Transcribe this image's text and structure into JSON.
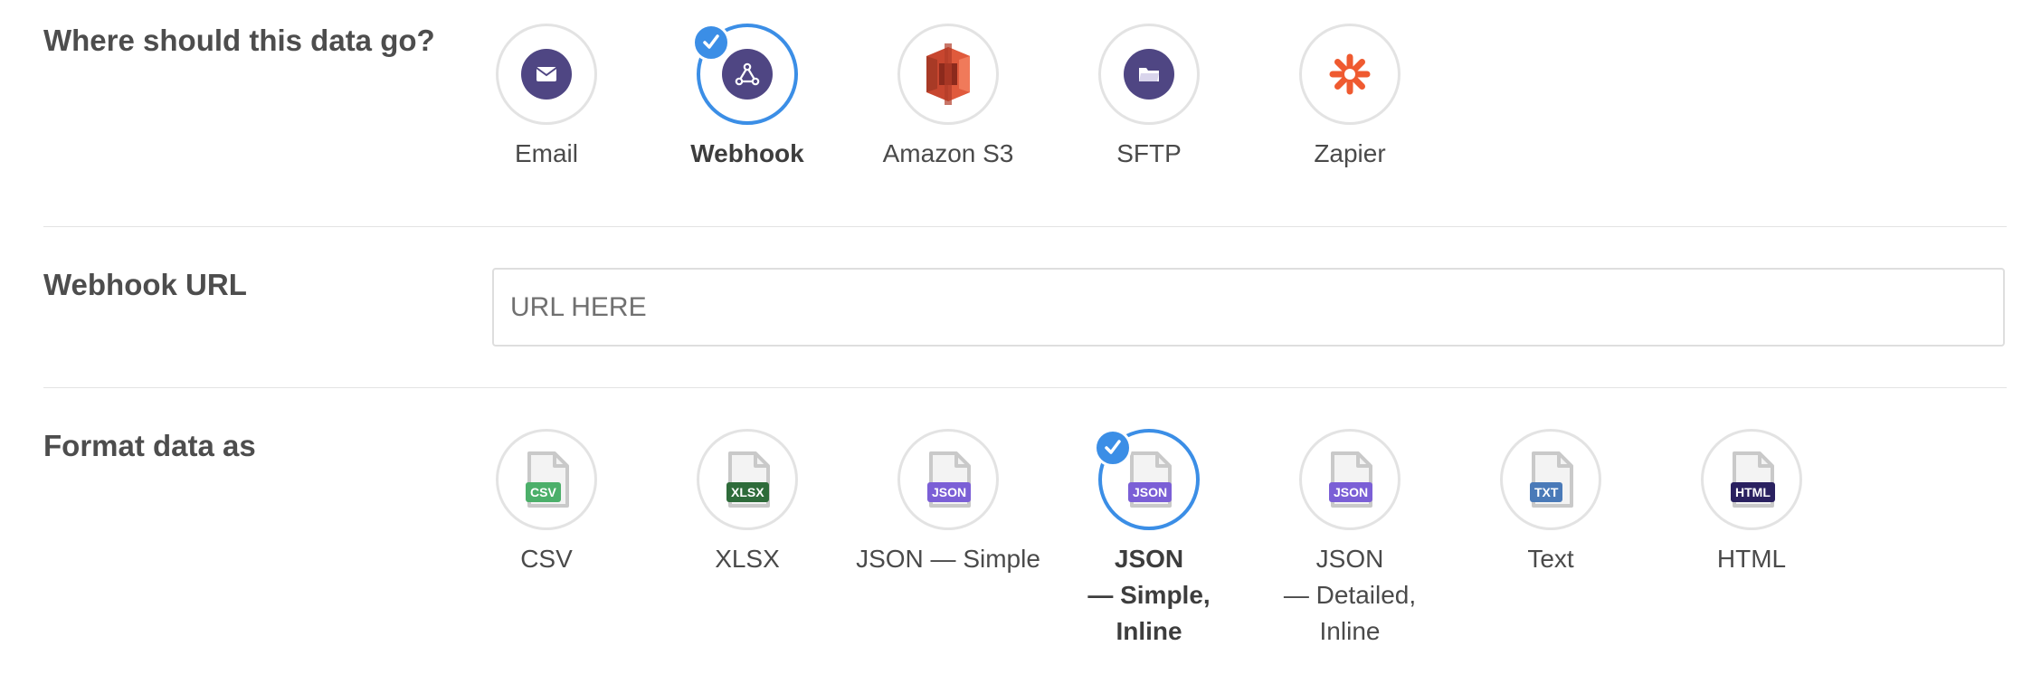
{
  "destination": {
    "label": "Where should this data go?",
    "options": [
      {
        "label": "Email",
        "icon": "email-icon",
        "selected": false
      },
      {
        "label": "Webhook",
        "icon": "webhook-icon",
        "selected": true
      },
      {
        "label": "Amazon S3",
        "icon": "amazon-s3-icon",
        "selected": false
      },
      {
        "label": "SFTP",
        "icon": "folder-icon",
        "selected": false
      },
      {
        "label": "Zapier",
        "icon": "zapier-icon",
        "selected": false
      }
    ]
  },
  "webhook": {
    "label": "Webhook URL",
    "placeholder": "URL HERE",
    "value": ""
  },
  "format": {
    "label": "Format data as",
    "options": [
      {
        "label": "CSV",
        "badge": "CSV",
        "badge_color": "#4caf6a",
        "selected": false
      },
      {
        "label": "XLSX",
        "badge": "XLSX",
        "badge_color": "#2e6b3a",
        "selected": false
      },
      {
        "label": "JSON — Simple",
        "badge": "JSON",
        "badge_color": "#7b5fd6",
        "selected": false
      },
      {
        "label": "JSON",
        "label_line2": "— Simple,",
        "label_line3": "Inline",
        "badge": "JSON",
        "badge_color": "#7b5fd6",
        "selected": true
      },
      {
        "label": "JSON",
        "label_line2": "— Detailed,",
        "label_line3": "Inline",
        "badge": "JSON",
        "badge_color": "#7b5fd6",
        "selected": false
      },
      {
        "label": "Text",
        "badge": "TXT",
        "badge_color": "#4a7ab8",
        "selected": false
      },
      {
        "label": "HTML",
        "badge": "HTML",
        "badge_color": "#2a2160",
        "selected": false
      }
    ]
  },
  "colors": {
    "accent": "#3b8ee6",
    "icon_purple": "#4f4683",
    "border": "#e3e3e3"
  }
}
